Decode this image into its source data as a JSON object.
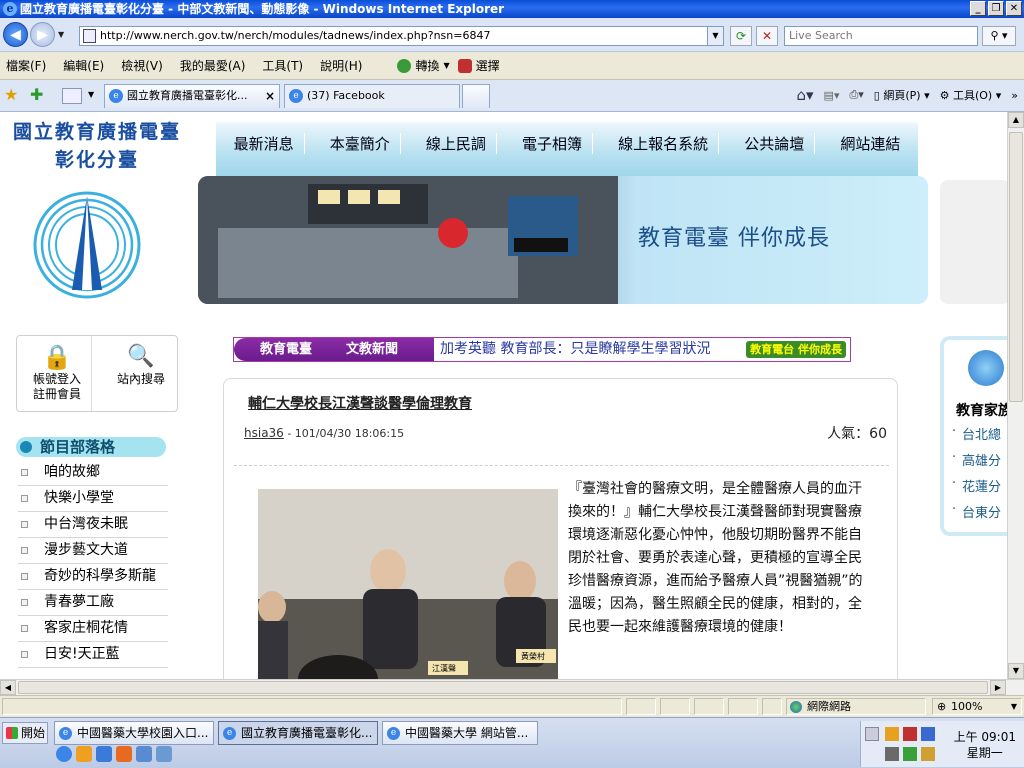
{
  "window": {
    "title": "國立教育廣播電臺彰化分臺 - 中部文教新聞、動態影像 - Windows Internet Explorer"
  },
  "addressbar": {
    "url": "http://www.nerch.gov.tw/nerch/modules/tadnews/index.php?nsn=6847",
    "search_placeholder": "Live Search"
  },
  "menubar": {
    "items": [
      "檔案(F)",
      "編輯(E)",
      "檢視(V)",
      "我的最愛(A)",
      "工具(T)",
      "說明(H)"
    ],
    "convert": "轉換",
    "select": "選擇"
  },
  "tabs": [
    {
      "label": "國立教育廣播電臺彰化..."
    },
    {
      "label": "(37) Facebook"
    }
  ],
  "commandbar": {
    "page": "網頁(P)",
    "tools": "工具(O)"
  },
  "site": {
    "title_line1": "國立教育廣播電臺",
    "title_line2": "彰化分臺",
    "login_label1": "帳號登入",
    "login_label2": "註冊會員",
    "search_label": "站內搜尋",
    "programs_title": "節目部落格",
    "programs": [
      "咱的故鄉",
      "快樂小學堂",
      "中台灣夜未眠",
      "漫步藝文大道",
      "奇妙的科學多斯龍",
      "青春夢工廠",
      "客家庄桐花情",
      "日安!天正藍"
    ],
    "nav": [
      "最新消息",
      "本臺簡介",
      "線上民調",
      "電子相簿",
      "線上報名系統",
      "公共論壇",
      "網站連結"
    ],
    "banner_text": "教育電臺  伴你成長",
    "ticker_label1": "教育電臺",
    "ticker_label2": "文教新聞",
    "ticker_text": "加考英聽 教育部長：只是瞭解學生學習狀況",
    "ticker_badge": "教育電台 伴你成長",
    "article": {
      "title": "輔仁大學校長江漢聲談醫學倫理教育",
      "author": "hsia36",
      "date": "- 101/04/30 18:06:15",
      "popularity": "人氣：60",
      "body": "『臺灣社會的醫療文明，是全體醫療人員的血汗換來的！』輔仁大學校長江漢聲醫師對現實醫療環境逐漸惡化憂心忡忡，他殷切期盼醫界不能自閉於社會、要勇於表達心聲，更積極的宣導全民珍惜醫療資源，進而給予醫療人員”視醫猶親”的溫暖；因為，醫生照顧全民的健康，相對的，全民也要一起來維護醫療環境的健康！",
      "nameplate_left": "江漢聲",
      "nameplate_right": "黃榮村"
    },
    "right_panel": {
      "title": "教育家族",
      "items": [
        "台北總",
        "高雄分",
        "花蓮分",
        "台東分"
      ]
    }
  },
  "statusbar": {
    "zone": "網際網路",
    "zoom": "100%"
  },
  "taskbar": {
    "start": "開始",
    "tasks": [
      {
        "label": "中國醫藥大學校園入口..."
      },
      {
        "label": "國立教育廣播電臺彰化..."
      },
      {
        "label": "中國醫藥大學 網站管..."
      }
    ],
    "time": "上午 09:01",
    "day": "星期一"
  }
}
